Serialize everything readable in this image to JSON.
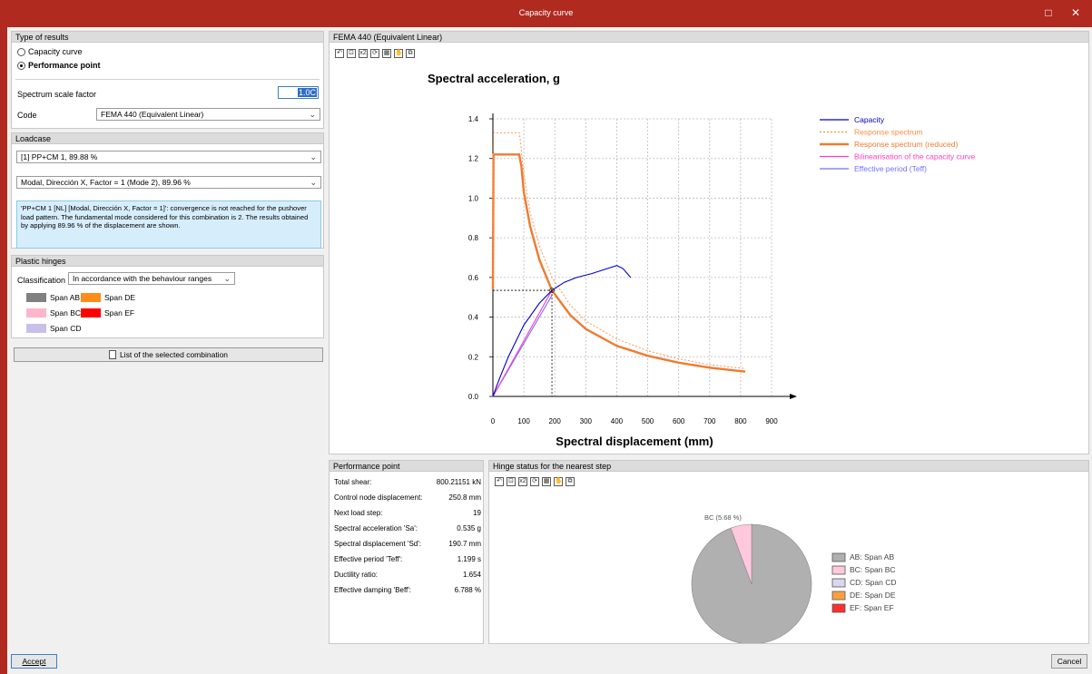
{
  "window": {
    "title": "Capacity curve",
    "maximize_glyph": "□",
    "close_glyph": "✕"
  },
  "results": {
    "header": "Type of results",
    "options": [
      "Capacity curve",
      "Performance point"
    ],
    "selected": "Performance point",
    "scale_label": "Spectrum scale factor",
    "scale_value": "1.0C",
    "code_label": "Code",
    "code_value": "FEMA 440 (Equivalent Linear)"
  },
  "loadcase": {
    "header": "Loadcase",
    "combo1": "[1] PP+CM 1, 89.88 %",
    "combo2": "Modal, Dirección X, Factor = 1 (Mode 2), 89.96 %",
    "note": "'PP+CM 1 [NL] [Modal, Dirección X, Factor = 1]': convergence is not reached for the pushover load pattern. The fundamental mode considered for this combination is 2. The results obtained by applying 89.96 % of the displacement are shown."
  },
  "hinges": {
    "header": "Plastic hinges",
    "classification_label": "Classification",
    "classification_value": "In accordance with the behaviour ranges",
    "spans": [
      {
        "label": "Span AB",
        "color": "#808080"
      },
      {
        "label": "Span DE",
        "color": "#ff8c1a"
      },
      {
        "label": "Span BC",
        "color": "#ffb6cc"
      },
      {
        "label": "Span EF",
        "color": "#ff0000"
      },
      {
        "label": "Span CD",
        "color": "#c8c0e8"
      }
    ]
  },
  "list_button": "List of the selected combination",
  "chart_panel": {
    "header": "FEMA 440 (Equivalent Linear)"
  },
  "toolbar_icons": [
    "undo-zoom-icon",
    "zoom-box-icon",
    "zoom-x2-icon",
    "reset-view-icon",
    "fit-icon",
    "pan-hand-icon",
    "copy-icon"
  ],
  "toolbar_glyphs": [
    "↶",
    "⊡",
    "x2",
    "⟳",
    "▦",
    "✋",
    "⧉"
  ],
  "chart_data": {
    "type": "line",
    "ylabel": "Spectral acceleration, g",
    "xlabel": "Spectral displacement (mm)",
    "xlim": [
      0,
      900
    ],
    "ylim": [
      0,
      1.4
    ],
    "xticks": [
      "0",
      "100",
      "200",
      "300",
      "400",
      "500",
      "600",
      "700",
      "800",
      "900"
    ],
    "yticks": [
      "0.0",
      "0.2",
      "0.4",
      "0.6",
      "0.8",
      "1.0",
      "1.2",
      "1.4"
    ],
    "grid": true,
    "legend_position": "top-right",
    "series": [
      {
        "name": "Capacity",
        "color": "#0000cc",
        "style": "solid",
        "x": [
          0,
          20,
          50,
          100,
          150,
          190.7,
          230,
          270,
          320,
          370,
          400,
          420,
          445
        ],
        "y": [
          0,
          0.085,
          0.2,
          0.36,
          0.47,
          0.535,
          0.575,
          0.6,
          0.62,
          0.645,
          0.66,
          0.645,
          0.6
        ]
      },
      {
        "name": "Response spectrum",
        "color": "#ff8c40",
        "style": "dashed",
        "x": [
          0,
          2,
          85,
          88,
          100,
          120,
          150,
          190.7,
          250,
          300,
          400,
          500,
          600,
          700,
          815
        ],
        "y": [
          0.54,
          1.33,
          1.33,
          1.3,
          1.12,
          0.93,
          0.76,
          0.6,
          0.46,
          0.38,
          0.29,
          0.23,
          0.19,
          0.16,
          0.14
        ]
      },
      {
        "name": "Response spectrum (reduced)",
        "color": "#f07a30",
        "style": "thick",
        "x": [
          0,
          2,
          85,
          92,
          100,
          120,
          150,
          190.7,
          250,
          300,
          400,
          500,
          600,
          700,
          815
        ],
        "y": [
          0.54,
          1.22,
          1.22,
          1.16,
          1.03,
          0.86,
          0.69,
          0.535,
          0.41,
          0.34,
          0.255,
          0.205,
          0.17,
          0.145,
          0.125
        ]
      },
      {
        "name": "Bilinearisation of the capacity curve",
        "color": "#ff3fbf",
        "style": "solid",
        "x": [
          0,
          190.7
        ],
        "y": [
          0,
          0.535
        ]
      },
      {
        "name": "Effective period (Teff)",
        "color": "#7070ff",
        "style": "solid",
        "x": [
          0,
          190.7
        ],
        "y": [
          0,
          0.51
        ]
      }
    ],
    "performance_point": {
      "x": 190.7,
      "y": 0.535
    }
  },
  "performance": {
    "header": "Performance point",
    "rows": [
      {
        "k": "Total shear:",
        "v": "800.21151 kN"
      },
      {
        "k": "Control node displacement:",
        "v": "250.8 mm"
      },
      {
        "k": "Next load step:",
        "v": "19"
      },
      {
        "k": "Spectral acceleration 'Sa':",
        "v": "0.535 g"
      },
      {
        "k": "Spectral displacement 'Sd':",
        "v": "190.7 mm"
      },
      {
        "k": "Effective period 'Teff':",
        "v": "1.199 s"
      },
      {
        "k": "Ductility ratio:",
        "v": "1.654"
      },
      {
        "k": "Effective damping 'Beff':",
        "v": "6.788 %"
      }
    ]
  },
  "hinge_status": {
    "header": "Hinge status for the nearest step",
    "pie": {
      "slices": [
        {
          "label": "AB (94.32 %)",
          "value": 94.32,
          "color": "#b0b0b0"
        },
        {
          "label": "BC (5.68 %)",
          "value": 5.68,
          "color": "#ffc8dc"
        }
      ],
      "legend": [
        {
          "label": "AB: Span AB",
          "color": "#b0b0b0"
        },
        {
          "label": "BC: Span BC",
          "color": "#ffc8dc"
        },
        {
          "label": "CD: Span CD",
          "color": "#dcd6f0"
        },
        {
          "label": "DE: Span DE",
          "color": "#ffa040"
        },
        {
          "label": "EF: Span EF",
          "color": "#ff3030"
        }
      ]
    }
  },
  "footer": {
    "accept": "Accept",
    "cancel": "Cancel"
  }
}
